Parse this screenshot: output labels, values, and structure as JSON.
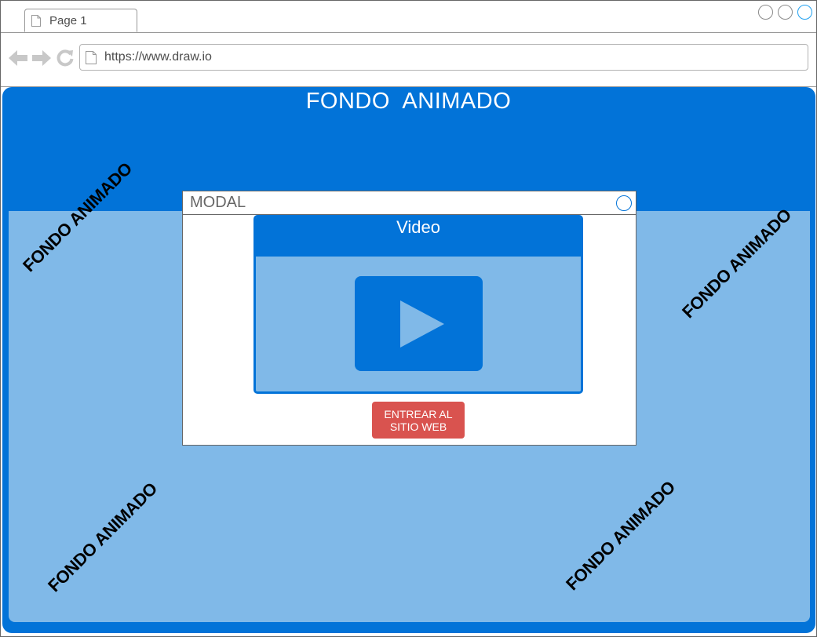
{
  "browser": {
    "tab_label": "Page 1",
    "url": "https://www.draw.io"
  },
  "page": {
    "title": "FONDO  ANIMADO",
    "diagonal_labels": [
      "FONDO ANIMADO",
      "FONDO ANIMADO",
      "FONDO ANIMADO",
      "FONDO ANIMADO"
    ]
  },
  "modal": {
    "title": "MODAL",
    "video_title": "Video",
    "enter_button": "ENTREAR AL SITIO WEB"
  },
  "colors": {
    "primary_blue": "#0273d8",
    "light_blue": "#80b9e8",
    "button_red": "#d9534f"
  },
  "icons": [
    "document-icon",
    "back-arrow-icon",
    "forward-arrow-icon",
    "reload-icon",
    "play-icon",
    "close-circle-icon"
  ]
}
